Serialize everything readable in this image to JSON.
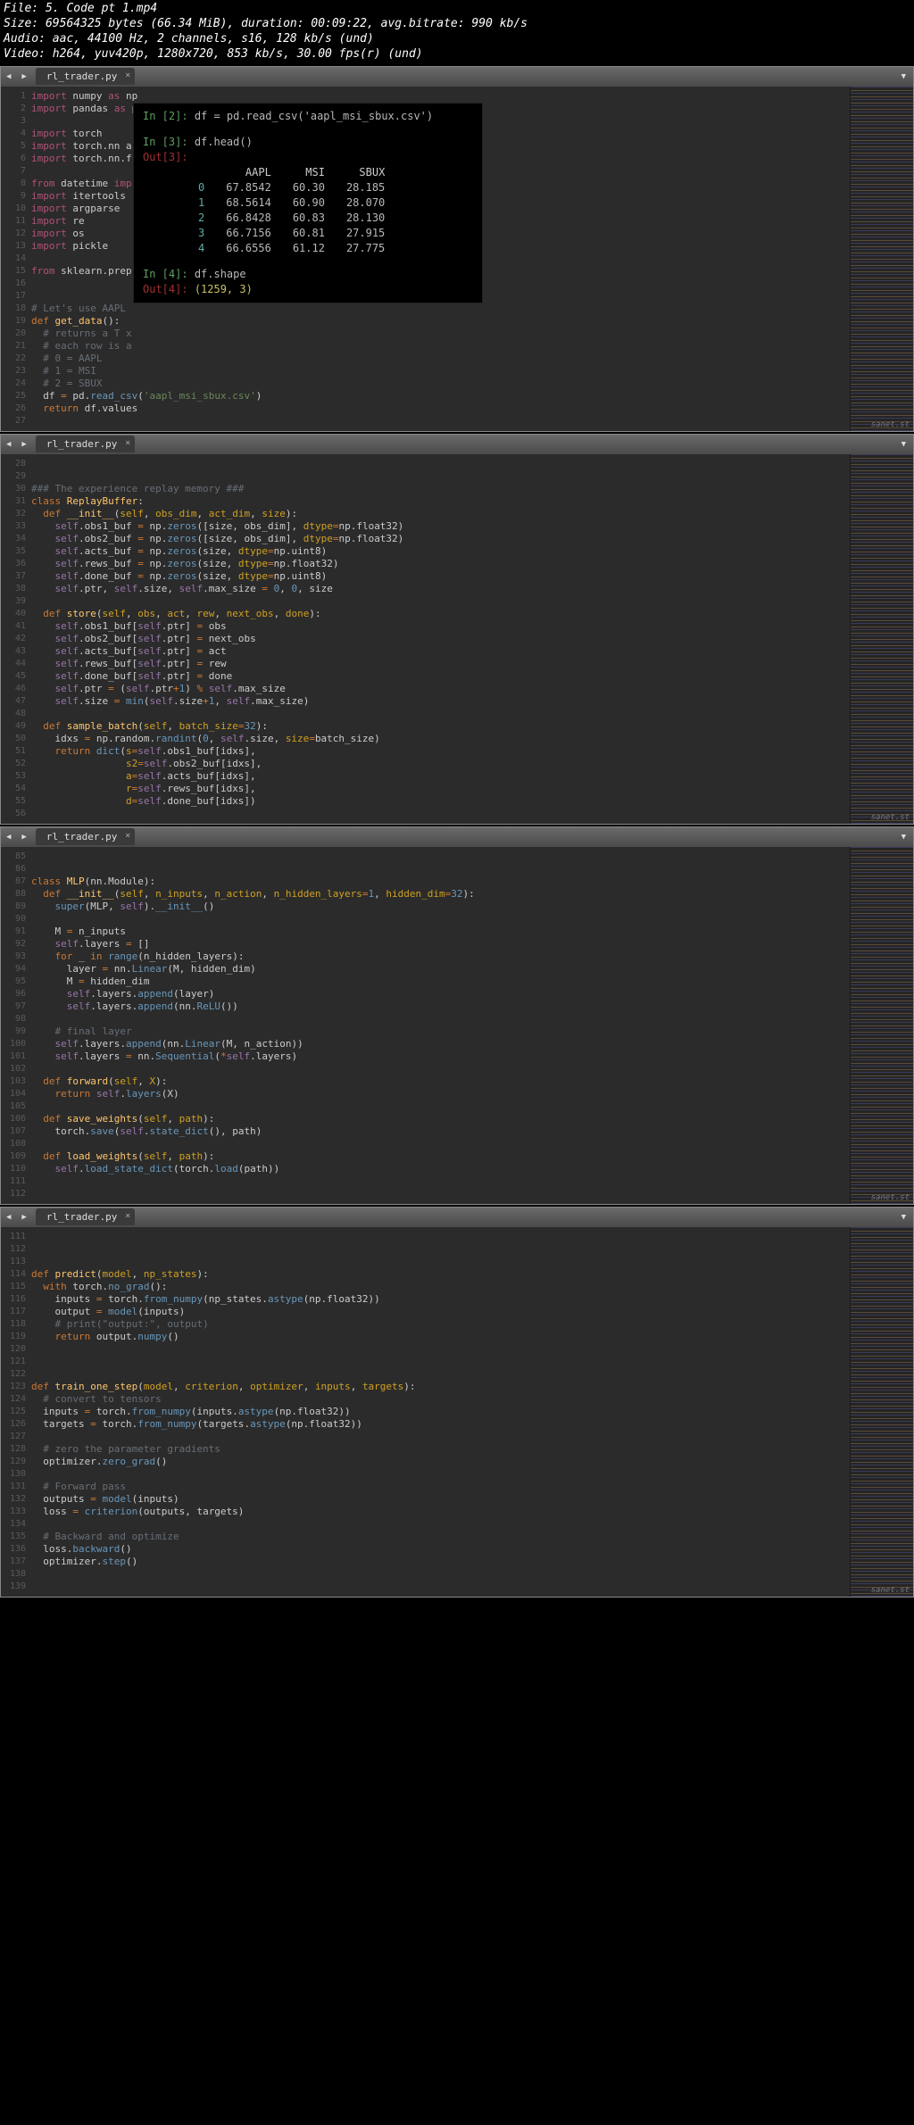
{
  "header": {
    "l1": "File: 5. Code pt 1.mp4",
    "l2": "Size: 69564325 bytes (66.34 MiB), duration: 00:09:22, avg.bitrate: 990 kb/s",
    "l3": "Audio: aac, 44100 Hz, 2 channels, s16, 128 kb/s (und)",
    "l4": "Video: h264, yuv420p, 1280x720, 853 kb/s, 30.00 fps(r) (und)"
  },
  "tab": "rl_trader.py",
  "close": "×",
  "watermark": "sanet.st",
  "pane1": {
    "start": 1,
    "end": 27
  },
  "pane2": {
    "start": 28,
    "end": 56
  },
  "pane3": {
    "start": 85,
    "end": 112
  },
  "pane4": {
    "start": 111,
    "end": 139
  },
  "terminal": {
    "in2": "In [2]:",
    "cmd2": "df = pd.read_csv('aapl_msi_sbux.csv')",
    "in3": "In [3]:",
    "cmd3": "df.head()",
    "out3": "Out[3]:",
    "cols": [
      "",
      "AAPL",
      "MSI",
      "SBUX"
    ],
    "rows": [
      [
        "0",
        "67.8542",
        "60.30",
        "28.185"
      ],
      [
        "1",
        "68.5614",
        "60.90",
        "28.070"
      ],
      [
        "2",
        "66.8428",
        "60.83",
        "28.130"
      ],
      [
        "3",
        "66.7156",
        "60.81",
        "27.915"
      ],
      [
        "4",
        "66.6556",
        "61.12",
        "27.775"
      ]
    ],
    "in4": "In [4]:",
    "cmd4": "df.shape",
    "out4": "Out[4]:",
    "res4": "(1259, 3)"
  },
  "code1": [
    "<span class='kw'>import</span> numpy <span class='kw'>as</span> np",
    "<span class='kw'>import</span> pandas <span class='kw'>as</span> pd",
    "",
    "<span class='kw'>import</span> torch",
    "<span class='kw'>import</span> torch.nn a",
    "<span class='kw'>import</span> torch.nn.f",
    "",
    "<span class='kw'>from</span> datetime <span class='kw'>imp</span>",
    "<span class='kw'>import</span> itertools",
    "<span class='kw'>import</span> argparse",
    "<span class='kw'>import</span> re",
    "<span class='kw'>import</span> os",
    "<span class='kw'>import</span> pickle",
    "",
    "<span class='kw'>from</span> sklearn.prep",
    "",
    "",
    "<span class='cm'># Let's use AAPL</span>",
    "<span class='kw2'>def</span> <span class='def'>get_data</span>():",
    "  <span class='cm'># returns a T x</span>",
    "  <span class='cm'># each row is a</span>",
    "  <span class='cm'># 0 = AAPL</span>",
    "  <span class='cm'># 1 = MSI</span>",
    "  <span class='cm'># 2 = SBUX</span>",
    "  df <span class='op'>=</span> pd.<span class='fn'>read_csv</span>(<span class='st'>'aapl_msi_sbux.csv'</span>)",
    "  <span class='kw2'>return</span> df.values",
    ""
  ],
  "code2": [
    "",
    "",
    "<span class='cm'>### The experience replay memory ###</span>",
    "<span class='kw2'>class</span> <span class='def'>ReplayBuffer</span>:",
    "  <span class='kw2'>def</span> <span class='def'>__init__</span>(<span class='prm'>self</span>, <span class='prm'>obs_dim</span>, <span class='prm'>act_dim</span>, <span class='prm'>size</span>):",
    "    <span class='id'>self</span>.obs1_buf <span class='op'>=</span> np.<span class='fn'>zeros</span>([size, obs_dim], <span class='prm'>dtype</span><span class='op'>=</span>np.float32)",
    "    <span class='id'>self</span>.obs2_buf <span class='op'>=</span> np.<span class='fn'>zeros</span>([size, obs_dim], <span class='prm'>dtype</span><span class='op'>=</span>np.float32)",
    "    <span class='id'>self</span>.acts_buf <span class='op'>=</span> np.<span class='fn'>zeros</span>(size, <span class='prm'>dtype</span><span class='op'>=</span>np.uint8)",
    "    <span class='id'>self</span>.rews_buf <span class='op'>=</span> np.<span class='fn'>zeros</span>(size, <span class='prm'>dtype</span><span class='op'>=</span>np.float32)",
    "    <span class='id'>self</span>.done_buf <span class='op'>=</span> np.<span class='fn'>zeros</span>(size, <span class='prm'>dtype</span><span class='op'>=</span>np.uint8)",
    "    <span class='id'>self</span>.ptr, <span class='id'>self</span>.size, <span class='id'>self</span>.max_size <span class='op'>=</span> <span class='num'>0</span>, <span class='num'>0</span>, size",
    "",
    "  <span class='kw2'>def</span> <span class='def'>store</span>(<span class='prm'>self</span>, <span class='prm'>obs</span>, <span class='prm'>act</span>, <span class='prm'>rew</span>, <span class='prm'>next_obs</span>, <span class='prm'>done</span>):",
    "    <span class='id'>self</span>.obs1_buf[<span class='id'>self</span>.ptr] <span class='op'>=</span> obs",
    "    <span class='id'>self</span>.obs2_buf[<span class='id'>self</span>.ptr] <span class='op'>=</span> next_obs",
    "    <span class='id'>self</span>.acts_buf[<span class='id'>self</span>.ptr] <span class='op'>=</span> act",
    "    <span class='id'>self</span>.rews_buf[<span class='id'>self</span>.ptr] <span class='op'>=</span> rew",
    "    <span class='id'>self</span>.done_buf[<span class='id'>self</span>.ptr] <span class='op'>=</span> done",
    "    <span class='id'>self</span>.ptr <span class='op'>=</span> (<span class='id'>self</span>.ptr<span class='op'>+</span><span class='num'>1</span>) <span class='op'>%</span> <span class='id'>self</span>.max_size",
    "    <span class='id'>self</span>.size <span class='op'>=</span> <span class='fn'>min</span>(<span class='id'>self</span>.size<span class='op'>+</span><span class='num'>1</span>, <span class='id'>self</span>.max_size)",
    "",
    "  <span class='kw2'>def</span> <span class='def'>sample_batch</span>(<span class='prm'>self</span>, <span class='prm'>batch_size</span><span class='op'>=</span><span class='num'>32</span>):",
    "    idxs <span class='op'>=</span> np.random.<span class='fn'>randint</span>(<span class='num'>0</span>, <span class='id'>self</span>.size, <span class='prm'>size</span><span class='op'>=</span>batch_size)",
    "    <span class='kw2'>return</span> <span class='fn'>dict</span>(<span class='prm'>s</span><span class='op'>=</span><span class='id'>self</span>.obs1_buf[idxs],",
    "                <span class='prm'>s2</span><span class='op'>=</span><span class='id'>self</span>.obs2_buf[idxs],",
    "                <span class='prm'>a</span><span class='op'>=</span><span class='id'>self</span>.acts_buf[idxs],",
    "                <span class='prm'>r</span><span class='op'>=</span><span class='id'>self</span>.rews_buf[idxs],",
    "                <span class='prm'>d</span><span class='op'>=</span><span class='id'>self</span>.done_buf[idxs])",
    ""
  ],
  "code3": [
    "",
    "",
    "<span class='kw2'>class</span> <span class='def'>MLP</span>(nn.Module):",
    "  <span class='kw2'>def</span> <span class='def'>__init__</span>(<span class='prm'>self</span>, <span class='prm'>n_inputs</span>, <span class='prm'>n_action</span>, <span class='prm'>n_hidden_layers</span><span class='op'>=</span><span class='num'>1</span>, <span class='prm'>hidden_dim</span><span class='op'>=</span><span class='num'>32</span>):",
    "    <span class='fn'>super</span>(MLP, <span class='id'>self</span>).<span class='fn'>__init__</span>()",
    "",
    "    M <span class='op'>=</span> n_inputs",
    "    <span class='id'>self</span>.layers <span class='op'>=</span> []",
    "    <span class='kw2'>for</span> _ <span class='kw2'>in</span> <span class='fn'>range</span>(n_hidden_layers):",
    "      layer <span class='op'>=</span> nn.<span class='fn'>Linear</span>(M, hidden_dim)",
    "      M <span class='op'>=</span> hidden_dim",
    "      <span class='id'>self</span>.layers.<span class='fn'>append</span>(layer)",
    "      <span class='id'>self</span>.layers.<span class='fn'>append</span>(nn.<span class='fn'>ReLU</span>())",
    "",
    "    <span class='cm'># final layer</span>",
    "    <span class='id'>self</span>.layers.<span class='fn'>append</span>(nn.<span class='fn'>Linear</span>(M, n_action))",
    "    <span class='id'>self</span>.layers <span class='op'>=</span> nn.<span class='fn'>Sequential</span>(<span class='op'>*</span><span class='id'>self</span>.layers)",
    "",
    "  <span class='kw2'>def</span> <span class='def'>forward</span>(<span class='prm'>self</span>, <span class='prm'>X</span>):",
    "    <span class='kw2'>return</span> <span class='id'>self</span>.<span class='fn'>layers</span>(X)",
    "",
    "  <span class='kw2'>def</span> <span class='def'>save_weights</span>(<span class='prm'>self</span>, <span class='prm'>path</span>):",
    "    torch.<span class='fn'>save</span>(<span class='id'>self</span>.<span class='fn'>state_dict</span>(), path)",
    "",
    "  <span class='kw2'>def</span> <span class='def'>load_weights</span>(<span class='prm'>self</span>, <span class='prm'>path</span>):",
    "    <span class='id'>self</span>.<span class='fn'>load_state_dict</span>(torch.<span class='fn'>load</span>(path))",
    "",
    ""
  ],
  "code4": [
    "",
    "",
    "",
    "<span class='kw2'>def</span> <span class='def'>predict</span>(<span class='prm'>model</span>, <span class='prm'>np_states</span>):",
    "  <span class='kw2'>with</span> torch.<span class='fn'>no_grad</span>():",
    "    inputs <span class='op'>=</span> torch.<span class='fn'>from_numpy</span>(np_states.<span class='fn'>astype</span>(np.float32))",
    "    output <span class='op'>=</span> <span class='fn'>model</span>(inputs)",
    "    <span class='cm'># print(\"output:\", output)</span>",
    "    <span class='kw2'>return</span> output.<span class='fn'>numpy</span>()",
    "",
    "",
    "",
    "<span class='kw2'>def</span> <span class='def'>train_one_step</span>(<span class='prm'>model</span>, <span class='prm'>criterion</span>, <span class='prm'>optimizer</span>, <span class='prm'>inputs</span>, <span class='prm'>targets</span>):",
    "  <span class='cm'># convert to tensors</span>",
    "  inputs <span class='op'>=</span> torch.<span class='fn'>from_numpy</span>(inputs.<span class='fn'>astype</span>(np.float32))",
    "  targets <span class='op'>=</span> torch.<span class='fn'>from_numpy</span>(targets.<span class='fn'>astype</span>(np.float32))",
    "",
    "  <span class='cm'># zero the parameter gradients</span>",
    "  optimizer.<span class='fn'>zero_grad</span>()",
    "",
    "  <span class='cm'># Forward pass</span>",
    "  outputs <span class='op'>=</span> <span class='fn'>model</span>(inputs)",
    "  loss <span class='op'>=</span> <span class='fn'>criterion</span>(outputs, targets)",
    "",
    "  <span class='cm'># Backward and optimize</span>",
    "  loss.<span class='fn'>backward</span>()",
    "  optimizer.<span class='fn'>step</span>()",
    "",
    ""
  ]
}
